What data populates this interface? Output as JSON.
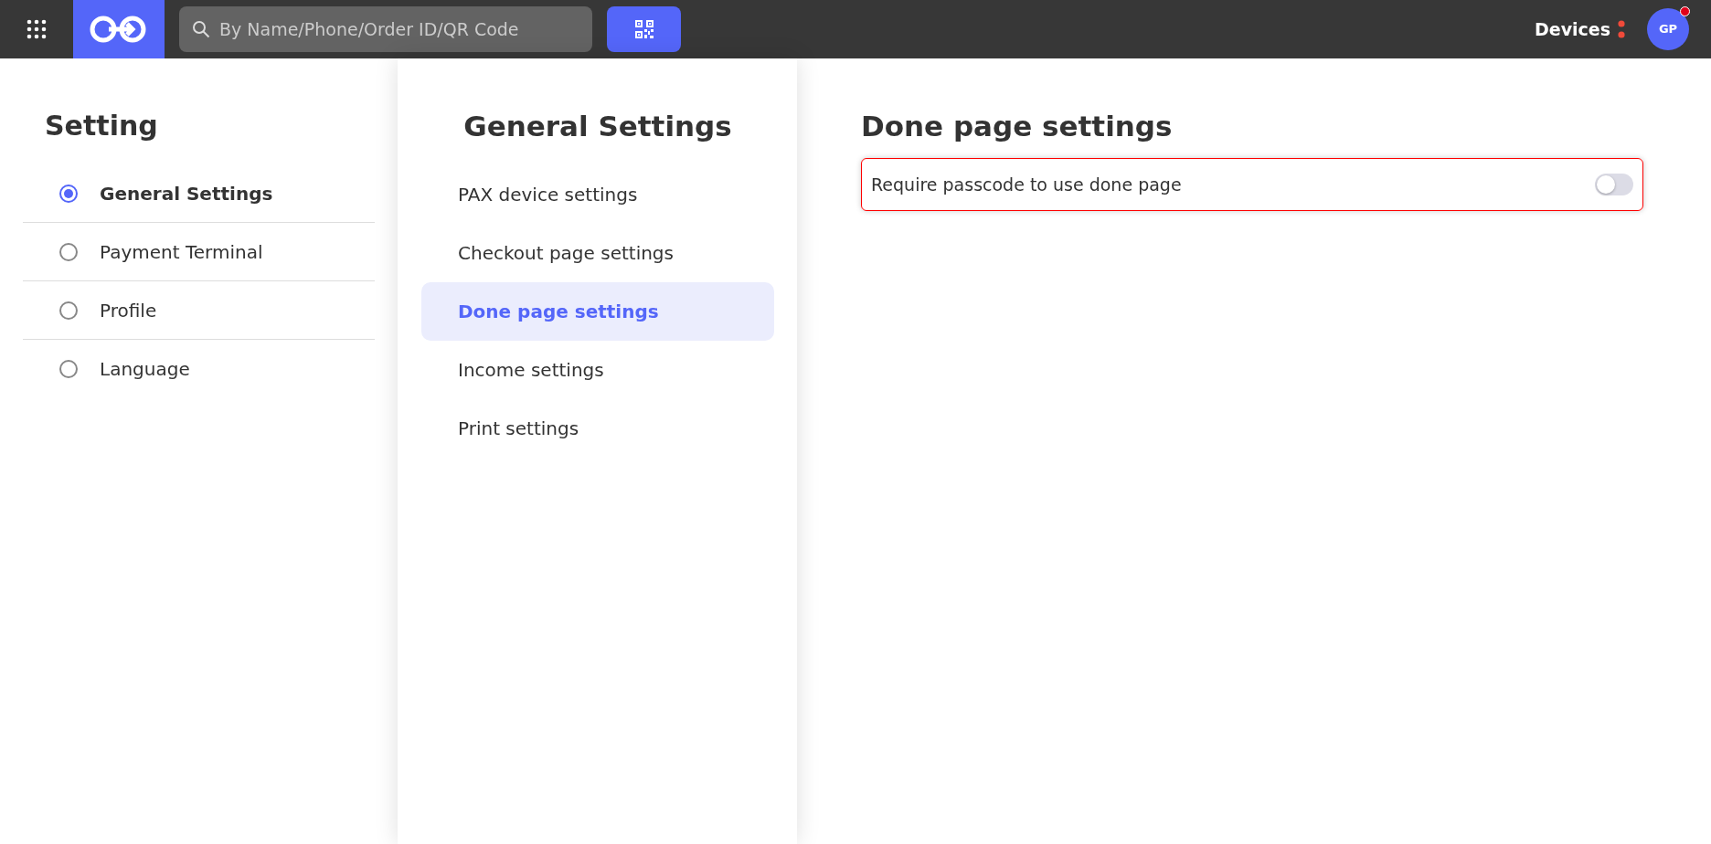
{
  "topbar": {
    "search": {
      "placeholder": "By Name/Phone/Order ID/QR Code"
    },
    "devices": {
      "label": "Devices",
      "alert": true
    },
    "avatar": {
      "initials": "GP",
      "notification": true
    }
  },
  "settings_menu": {
    "title": "Setting",
    "items": [
      {
        "label": "General Settings",
        "selected": true
      },
      {
        "label": "Payment Terminal",
        "selected": false
      },
      {
        "label": "Profile",
        "selected": false
      },
      {
        "label": "Language",
        "selected": false
      }
    ]
  },
  "general_settings": {
    "title": "General Settings",
    "items": [
      {
        "label": "PAX device settings",
        "selected": false
      },
      {
        "label": "Checkout page settings",
        "selected": false
      },
      {
        "label": "Done page settings",
        "selected": true
      },
      {
        "label": "Income settings",
        "selected": false
      },
      {
        "label": "Print settings",
        "selected": false
      }
    ]
  },
  "detail": {
    "title": "Done page settings",
    "options": [
      {
        "label": "Require passcode to use done page",
        "on": false,
        "highlighted": true
      }
    ]
  }
}
